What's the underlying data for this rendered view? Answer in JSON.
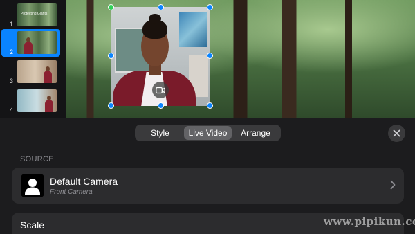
{
  "slides": [
    {
      "number": "1",
      "caption": "Protecting Giants",
      "selected": false
    },
    {
      "number": "2",
      "caption": "",
      "selected": true
    },
    {
      "number": "3",
      "caption": "",
      "selected": false
    },
    {
      "number": "4",
      "caption": "",
      "selected": false
    }
  ],
  "accent_color": "#0a84ff",
  "tabs": [
    {
      "label": "Style",
      "active": false
    },
    {
      "label": "Live Video",
      "active": true
    },
    {
      "label": "Arrange",
      "active": false
    }
  ],
  "source": {
    "section_label": "SOURCE",
    "camera_name": "Default Camera",
    "camera_detail": "Front Camera"
  },
  "scale": {
    "label": "Scale"
  },
  "watermark": "www.pipikun.com",
  "icons": {
    "close": "close-icon",
    "chevron": "chevron-right-icon",
    "camera": "video-camera-icon",
    "person": "person-icon"
  }
}
